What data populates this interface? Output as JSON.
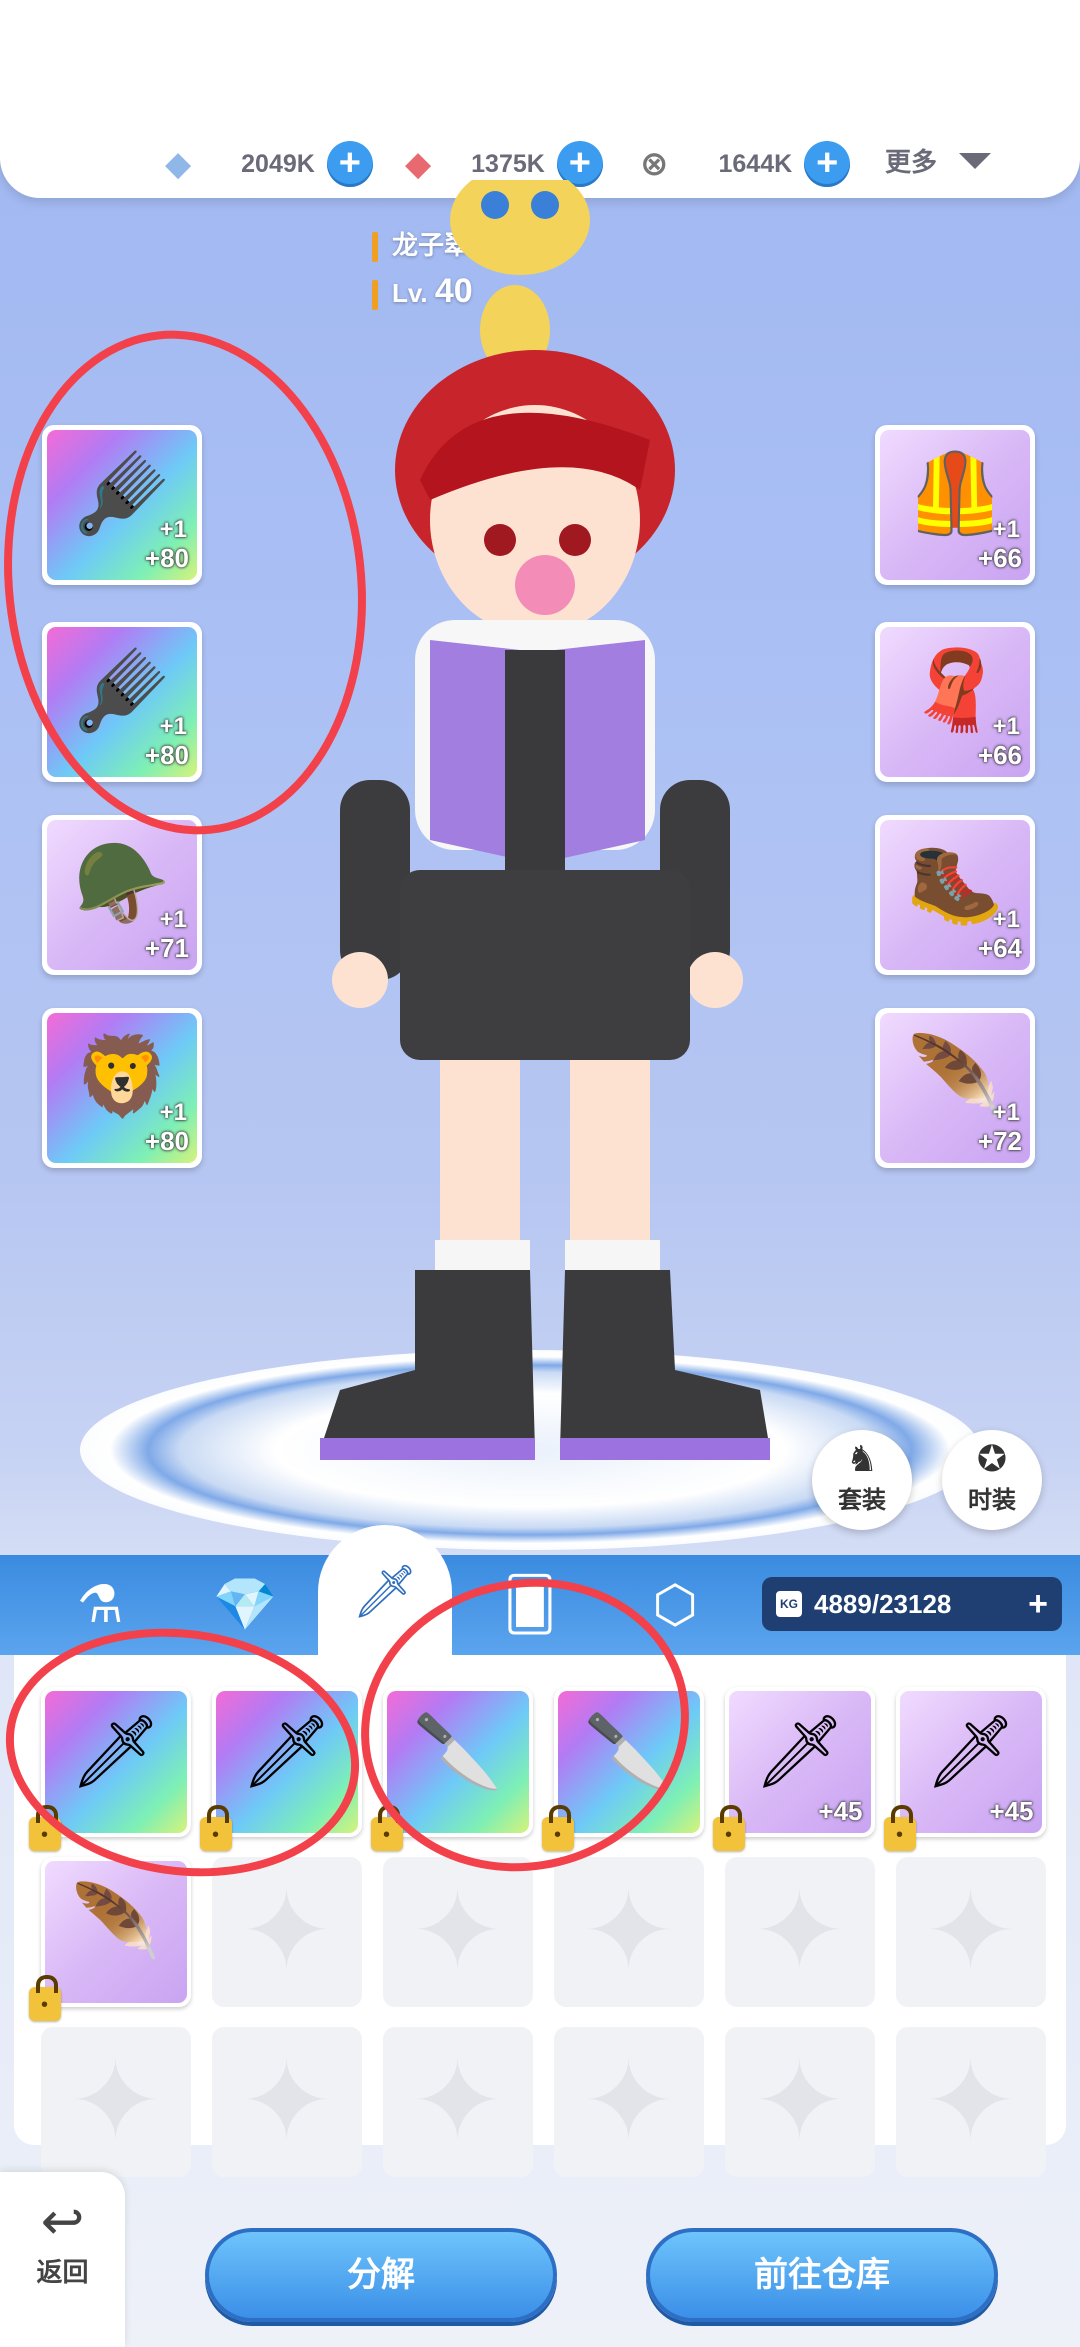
{
  "currency": [
    {
      "icon": "diamond-icon",
      "value": "2049K"
    },
    {
      "icon": "ruby-icon",
      "value": "1375K"
    },
    {
      "icon": "coin-icon",
      "value": "1644K"
    }
  ],
  "more_label": "更多",
  "character": {
    "name": "龙子翠",
    "level_prefix": "Lv.",
    "level": "40",
    "title_icon": "crossed-swords-icon"
  },
  "left_slots": [
    {
      "icon": "claw-weapon-icon",
      "refine": "+1",
      "enhance": "+80",
      "rarity": "rainbow"
    },
    {
      "icon": "claw-weapon-icon",
      "refine": "+1",
      "enhance": "+80",
      "rarity": "rainbow"
    },
    {
      "icon": "helmet-icon",
      "refine": "+1",
      "enhance": "+71",
      "rarity": "violet"
    },
    {
      "icon": "lion-pet-icon",
      "refine": "+1",
      "enhance": "+80",
      "rarity": "rainbow"
    }
  ],
  "right_slots": [
    {
      "icon": "armor-icon",
      "refine": "+1",
      "enhance": "+66",
      "rarity": "violet"
    },
    {
      "icon": "cloak-icon",
      "refine": "+1",
      "enhance": "+66",
      "rarity": "violet"
    },
    {
      "icon": "boots-icon",
      "refine": "+1",
      "enhance": "+64",
      "rarity": "violet"
    },
    {
      "icon": "wing-icon",
      "refine": "+1",
      "enhance": "+72",
      "rarity": "violet"
    }
  ],
  "set_buttons": [
    {
      "icon": "outfit-set-icon",
      "label": "套装"
    },
    {
      "icon": "fashion-icon",
      "label": "时装"
    }
  ],
  "bag_tabs": [
    {
      "icon": "potion-icon"
    },
    {
      "icon": "gem-icon"
    },
    {
      "icon": "sword-icon",
      "active": true
    },
    {
      "icon": "cards-icon"
    },
    {
      "icon": "crystal-icon"
    }
  ],
  "capacity": {
    "badge": "KG",
    "value": "4889/23128"
  },
  "bag_items": [
    {
      "icon": "sword-icon",
      "glyph": "🗡",
      "rarity": "rainbow",
      "locked": true,
      "level": ""
    },
    {
      "icon": "sword-icon",
      "glyph": "🗡",
      "rarity": "rainbow",
      "locked": true,
      "level": ""
    },
    {
      "icon": "curved-blade-icon",
      "glyph": "🔪",
      "rarity": "rainbow",
      "locked": true,
      "level": ""
    },
    {
      "icon": "curved-blade-icon",
      "glyph": "🔪",
      "rarity": "rainbow",
      "locked": true,
      "level": ""
    },
    {
      "icon": "dagger-icon",
      "glyph": "🗡",
      "rarity": "violet",
      "locked": true,
      "level": "+45"
    },
    {
      "icon": "dagger-icon",
      "glyph": "🗡",
      "rarity": "violet",
      "locked": true,
      "level": "+45"
    },
    {
      "icon": "wing-icon",
      "glyph": "🪶",
      "rarity": "violet",
      "locked": true,
      "level": ""
    }
  ],
  "buttons": {
    "back": "返回",
    "decompose": "分解",
    "warehouse": "前往仓库"
  }
}
